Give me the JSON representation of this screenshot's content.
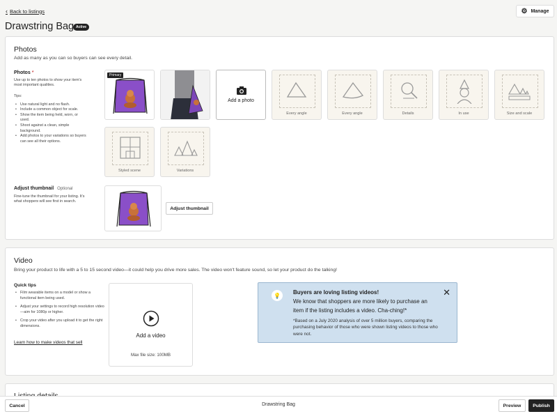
{
  "header": {
    "back_label": "Back to listings",
    "title": "Drawstring Bag",
    "status_badge": "Active",
    "manage_label": "Manage"
  },
  "photos": {
    "heading": "Photos",
    "subtitle": "Add as many as you can so buyers can see every detail.",
    "side_title": "Photos",
    "required_mark": "*",
    "side_desc": "Use up to ten photos to show your item's most important qualities.",
    "tips_heading": "Tips:",
    "tips": [
      "Use natural light and no flash.",
      "Include a common object for scale.",
      "Show the item being held, worn, or used.",
      "Shoot against a clean, simple background.",
      "Add photos to your variations so buyers can see all their options."
    ],
    "primary_label": "Primary",
    "add_photo_label": "Add a photo",
    "placeholders": [
      "Every angle",
      "Every angle",
      "Details",
      "In use",
      "Size and scale",
      "Styled scene",
      "Variations"
    ],
    "thumb_title": "Adjust thumbnail",
    "thumb_optional": "Optional",
    "thumb_desc": "Fine-tune the thumbnail for your listing. It's what shoppers will see first in search.",
    "thumb_button": "Adjust thumbnail"
  },
  "video": {
    "heading": "Video",
    "subtitle": "Bring your product to life with a 5 to 15 second video—it could help you drive more sales. The video won't feature sound, so let your product do the talking!",
    "tips_title": "Quick tips",
    "tips": [
      "Film wearable items on a model or show a functional item being used.",
      "Adjust your settings to record high resolution video—aim for 1080p or higher.",
      "Crop your video after you upload it to get the right dimensions."
    ],
    "learn_link": "Learn how to make videos that sell",
    "add_label": "Add a video",
    "max_size": "Max file size: 100MB",
    "info_title": "Buyers are loving listing videos!",
    "info_body": "We know that shoppers are more likely to purchase an item if the listing includes a video. Cha-ching!*",
    "info_footnote": "*Based on a July 2020 analysis of over 5 million buyers, comparing the purchasing behavior of those who were shown listing videos to those who were not."
  },
  "listing": {
    "heading": "Listing details"
  },
  "footer": {
    "cancel": "Cancel",
    "center_title": "Drawstring Bag",
    "preview": "Preview",
    "publish": "Publish"
  },
  "colors": {
    "bag_purple": "#8a4fc8",
    "info_bg": "#cfe0ef",
    "dark": "#222222"
  }
}
